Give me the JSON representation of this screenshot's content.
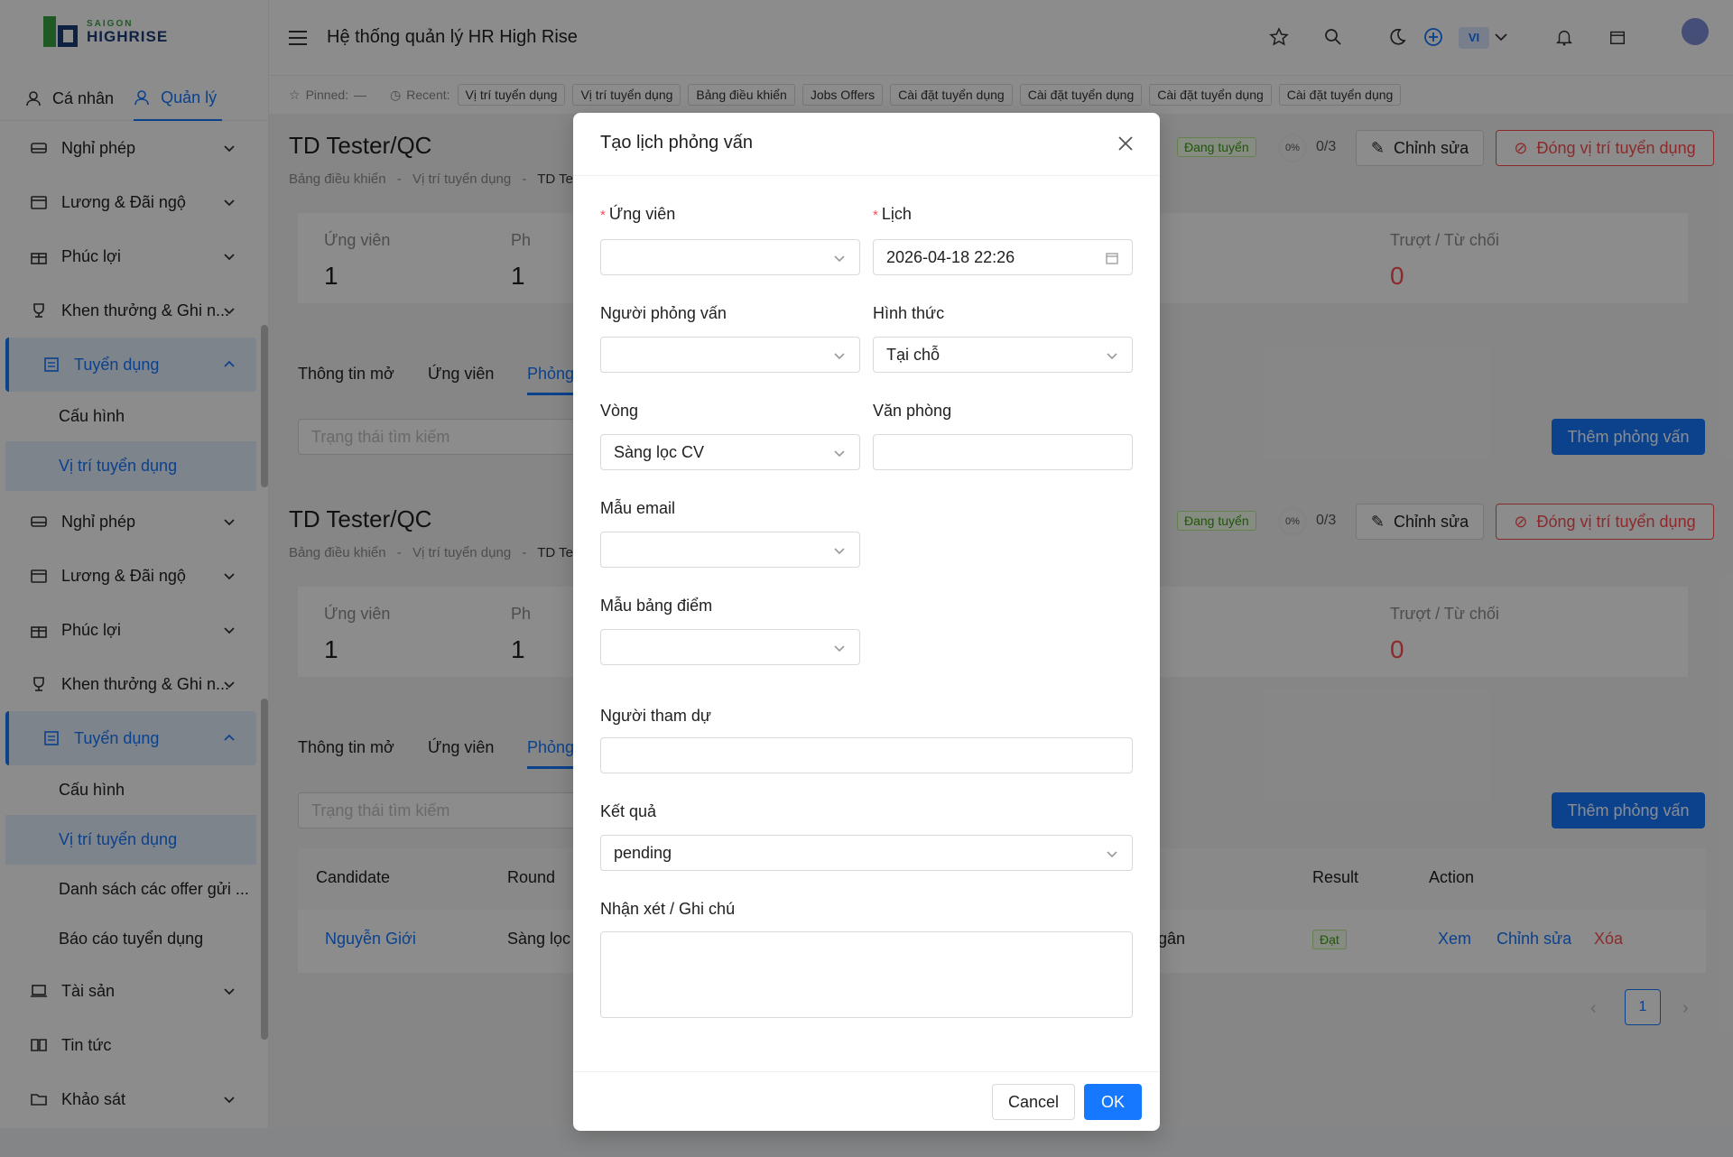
{
  "sidebar": {
    "logo_top": "SAIGON",
    "logo_bottom": "HIGHRISE",
    "mode_personal": "Cá nhân",
    "mode_manage": "Quản lý",
    "group1": {
      "leave": "Nghỉ phép",
      "salary": "Lương & Đãi ngộ",
      "benefits": "Phúc lợi",
      "rewards": "Khen thưởng & Ghi n...",
      "recruit": "Tuyển dụng",
      "config": "Cấu hình",
      "positions": "Vị trí tuyển dụng"
    },
    "group2": {
      "leave": "Nghỉ phép",
      "salary": "Lương & Đãi ngộ",
      "benefits": "Phúc lợi",
      "rewards": "Khen thưởng & Ghi n...",
      "recruit": "Tuyển dụng",
      "config": "Cấu hình",
      "positions": "Vị trí tuyển dụng",
      "offers": "Danh sách các offer gửi ...",
      "report": "Báo cáo tuyển dụng",
      "assets": "Tài sản",
      "news": "Tin tức",
      "survey": "Khảo sát"
    }
  },
  "header": {
    "title": "Hệ thống quản lý HR High Rise",
    "lang": "VI"
  },
  "recent": {
    "pinned_label": "Pinned:",
    "pinned_value": "—",
    "recent_label": "Recent:",
    "chips": [
      "Vị trí tuyển dụng",
      "Vị trí tuyển dụng",
      "Bảng điều khiển",
      "Jobs Offers",
      "Cài đặt tuyển dụng",
      "Cài đặt tuyển dụng",
      "Cài đặt tuyển dụng",
      "Cài đặt tuyển dụng"
    ]
  },
  "page": {
    "title": "TD Tester/QC",
    "crumb1": "Bảng điều khiển",
    "crumb2": "Vị trí tuyển dụng",
    "crumb3": "TD Tes",
    "crumb_sep": "-",
    "status": "Đang tuyển",
    "progress": "0%",
    "progress_count": "0/3",
    "edit_btn": "Chỉnh sửa",
    "close_btn": "Đóng vị trí tuyển dụng",
    "stat_candidates_label": "Ứng viên",
    "stat_candidates_value": "1",
    "stat_ph_label": "Ph",
    "stat_ph_value": "1",
    "stat_reject_label": "Trượt / Từ chối",
    "stat_reject_value": "0",
    "tab_info": "Thông tin mở",
    "tab_candidates": "Ứng viên",
    "tab_interview": "Phỏng",
    "search_placeholder": "Trạng thái tìm kiếm",
    "add_interview_btn": "Thêm phỏng vấn"
  },
  "table": {
    "headers": {
      "candidate": "Candidate",
      "round": "Round",
      "result": "Result",
      "action": "Action"
    },
    "row": {
      "candidate": "Nguyễn Giới",
      "round": "Sàng lọc",
      "partial": "gân",
      "result": "Đạt",
      "view": "Xem",
      "edit": "Chỉnh sửa",
      "delete": "Xóa"
    },
    "page": "1"
  },
  "modal": {
    "title": "Tạo lịch phỏng vấn",
    "candidate_label": "Ứng viên",
    "schedule_label": "Lịch",
    "schedule_value": "2026-04-18 22:26",
    "interviewer_label": "Người phỏng vấn",
    "format_label": "Hình thức",
    "format_value": "Tại chỗ",
    "round_label": "Vòng",
    "round_value": "Sàng lọc CV",
    "office_label": "Văn phòng",
    "email_tpl_label": "Mẫu email",
    "score_tpl_label": "Mẫu bảng điểm",
    "attendees_label": "Người tham dự",
    "result_label": "Kết quả",
    "result_value": "pending",
    "notes_label": "Nhận xét / Ghi chú",
    "required_mark": "*",
    "cancel": "Cancel",
    "ok": "OK"
  },
  "colors": {
    "primary": "#1677ff",
    "danger": "#ff4d4f",
    "success": "#389e0d"
  }
}
